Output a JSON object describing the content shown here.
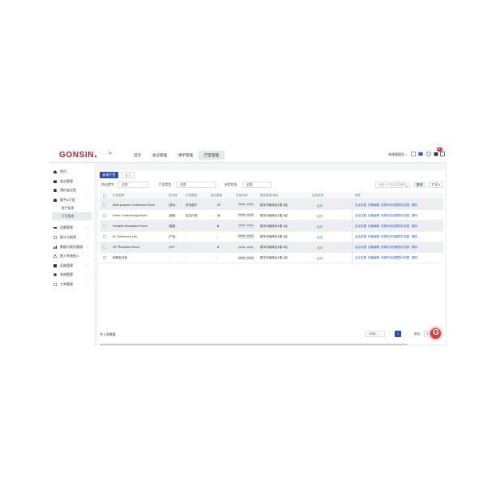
{
  "header": {
    "logo": "GONSIN",
    "collapse_icon": ">",
    "tabs": [
      {
        "label": "首页"
      },
      {
        "label": "会议管理"
      },
      {
        "label": "楼宇管理"
      },
      {
        "label": "厅室管理"
      }
    ],
    "active_tab": 3,
    "user": "系统管理员",
    "notification_count": "99+"
  },
  "sidebar": {
    "items": [
      {
        "label": "首页",
        "icon": "home-icon",
        "expand": false
      },
      {
        "label": "会议管理",
        "icon": "calendar-icon",
        "expand": false
      },
      {
        "label": "预约会议室",
        "icon": "booking-icon",
        "expand": true
      },
      {
        "label": "楼宇&厅室",
        "icon": "building-icon",
        "expand": true,
        "children": [
          {
            "label": "楼宇管理"
          },
          {
            "label": "厅室管理"
          }
        ]
      },
      {
        "label": "设备管理",
        "icon": "device-icon",
        "expand": true
      },
      {
        "label": "统计与报表",
        "icon": "report-icon",
        "expand": true
      },
      {
        "label": "数据可视化管理",
        "icon": "chart-icon",
        "expand": true
      },
      {
        "label": "接入系统接入",
        "icon": "network-icon",
        "expand": true
      },
      {
        "label": "运维管理",
        "icon": "ops-icon",
        "expand": true
      },
      {
        "label": "系统管理",
        "icon": "settings-icon",
        "expand": true
      },
      {
        "label": "工单管理",
        "icon": "ticket-icon",
        "expand": true
      }
    ],
    "active_child": "厅室管理"
  },
  "toolbar": {
    "add_label": "新建厅室",
    "delete_label": "删除"
  },
  "filters": {
    "building_label": "所在楼宇:",
    "building_value": "全部",
    "type_label": "厅室类型:",
    "type_value": "全部",
    "status_label": "启用状态:",
    "status_value": "全部",
    "search_placeholder": "请输入厅室名称或编号",
    "query_label": "查询",
    "import_label": "导入"
  },
  "table": {
    "columns": [
      "厅室名称",
      "所在楼",
      "厅室类型",
      "座位数量",
      "开放时段",
      "楼宇楼层/地址",
      "启用状态",
      "操作"
    ],
    "rows": [
      {
        "name": "Multi-purpose Conference Room",
        "building": "(多功...",
        "type": "多功能厅",
        "seats": "17",
        "time": "08:00 - 22:00",
        "address": "楼宇详细地址1楼 A区",
        "status": "启用",
        "shaded": true
      },
      {
        "name": "Video Conferencing Room",
        "building": "(视频...",
        "type": "会议厅室",
        "seats": "11",
        "time": "08:00 - 22:00",
        "address": "楼宇详细地址1楼 A区",
        "status": "启用",
        "shaded": false
      },
      {
        "name": "Versatile Discussion Room",
        "building": "(智能...",
        "type": "-",
        "seats": "8",
        "time": "08:00 - 22:00",
        "address": "楼宇详细地址1楼 A区",
        "status": "启用",
        "shaded": true
      },
      {
        "name": "AI Conference Lab",
        "building": "(产品...",
        "type": "-",
        "seats": "-",
        "time": "08:00 - 22:00",
        "address": "楼宇详细地址1楼 A区",
        "status": "启用",
        "shaded": false
      },
      {
        "name": "VIP Reception Room",
        "building": "(VIP...",
        "type": "-",
        "seats": "4",
        "time": "08:00 - 22:00",
        "address": "楼宇详细地址1楼 A区",
        "status": "启用",
        "shaded": true
      },
      {
        "name": "视频会议室",
        "building": "-",
        "type": "-",
        "seats": "-",
        "time": "08:00 - 22:00",
        "address": "楼宇详细地址1楼 A区",
        "status": "启用",
        "shaded": false
      }
    ],
    "actions": [
      "会议设置",
      "设备编辑",
      "资源时段设置",
      "预约设置",
      "删除"
    ]
  },
  "footer": {
    "total": "共 6 条数据",
    "page_size": "10/页",
    "prev": "<",
    "current_page": "1",
    "next": ">",
    "goto_label": "前往",
    "goto_value": "1"
  },
  "colors": {
    "brand": "#b5262d",
    "primary": "#2b4ea8",
    "link": "#2b5fd0",
    "success": "#2aa55b"
  }
}
